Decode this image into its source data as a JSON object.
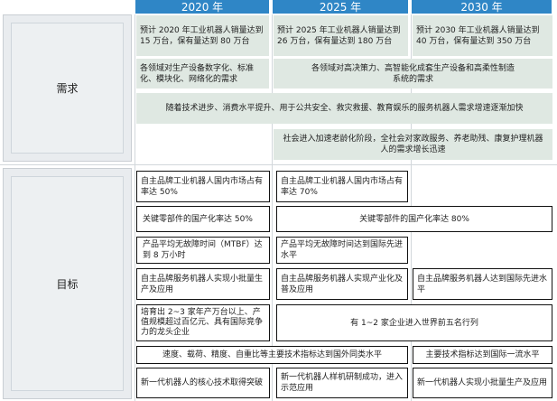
{
  "headers": {
    "y2020": "2020 年",
    "y2025": "2025 年",
    "y2030": "2030 年"
  },
  "sections": {
    "demand": "需求",
    "goals": "目标"
  },
  "demand": {
    "d2020_sales": "预计 2020 年工业机器人销量达到 15 万台，保有量达到 80 万台",
    "d2025_sales": "预计 2025 年工业机器人销量达到 26 万台，保有量达到 180 万台",
    "d2030_sales": "预计 2030 年工业机器人销量达到 40 万台，保有量达到 350 万台",
    "d2020_fields": "各领域对生产设备数字化、标准化、模块化、网络化的需求",
    "d2025_fields": "各领域对高决策力、高智能化成套生产设备和高柔性制造系统的需求",
    "service_growth": "随着技术进步、消费水平提升、用于公共安全、救灾救援、教育娱乐的服务机器人需求增速逐渐加快",
    "aging": "社会进入加速老龄化阶段，全社会对家政服务、养老助残、康复护理机器人的需求增长迅速"
  },
  "goals": {
    "g2020_share": "自主品牌工业机器人国内市场占有率达 50%",
    "g2025_share": "自主品牌工业机器人国内市场占有率达 70%",
    "g2020_parts": "关键零部件的国产化率达 50%",
    "g2025_parts": "关键零部件的国产化率达 80%",
    "g2020_mtbf": "产品平均无故障时间（MTBF）达到 8 万小时",
    "g2025_mtbf": "产品平均无故障时间达到国际先进水平",
    "g2020_service": "自主品牌服务机器人实现小批量生产及应用",
    "g2025_service": "自主品牌服务机器人实现产业化及普及应用",
    "g2030_service": "自主品牌服务机器人达到国际先进水平",
    "g2020_leaders": "培育出 2~3 家年产万台以上、产值规模超过百亿元、具有国际竞争力的龙头企业",
    "g2025_top5": "有 1~2 家企业进入世界前五名行列",
    "g2025_indicators": "速度、载荷、精度、自重比等主要技术指标达到国外同类水平",
    "g2030_indicators": "主要技术指标达到国际一流水平",
    "g2020_core": "新一代机器人的核心技术取得突破",
    "g2025_humanoid": "新一代机器人样机研制成功，进入示范应用",
    "g2030_batch": "新一代机器人实现小批量生产及应用"
  }
}
